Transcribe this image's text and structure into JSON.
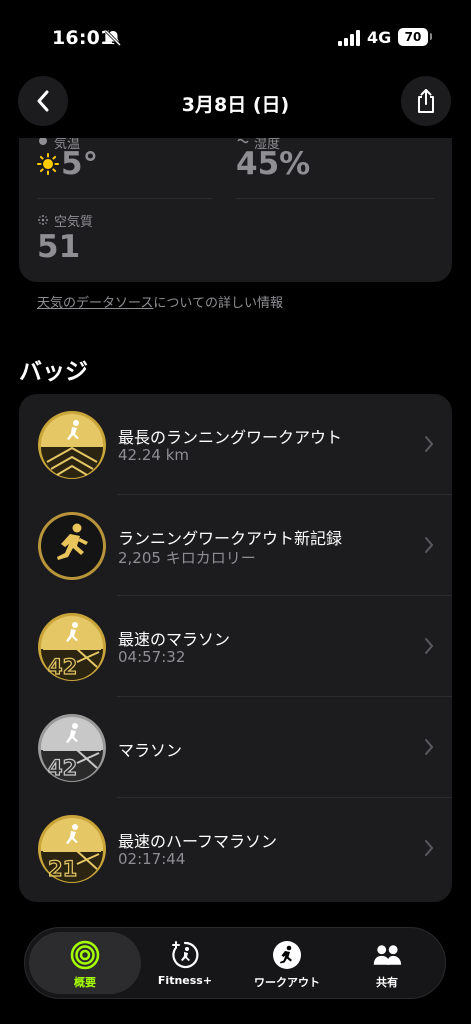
{
  "status_bar": {
    "time": "16:01",
    "network": "4G",
    "battery": "70"
  },
  "nav": {
    "title": "3月8日 (日)"
  },
  "weather": {
    "temp_label": "気温",
    "temp_value": "5°",
    "humidity_label": "湿度",
    "humidity_value": "45%",
    "air_label": "空気質",
    "air_value": "51",
    "source_link": "天気のデータソース",
    "source_suffix": "についての詳しい情報"
  },
  "badges": {
    "section_title": "バッジ",
    "items": [
      {
        "title": "最長のランニングワークアウト",
        "subtitle": "42.24 km",
        "medal": "gold-longest-run-badge-icon"
      },
      {
        "title": "ランニングワークアウト新記録",
        "subtitle": "2,205 キロカロリー",
        "medal": "black-gold-running-record-badge-icon"
      },
      {
        "title": "最速のマラソン",
        "subtitle": "04:57:32",
        "medal": "gold-marathon-42-badge-icon"
      },
      {
        "title": "マラソン",
        "subtitle": "",
        "medal": "silver-marathon-42-badge-icon"
      },
      {
        "title": "最速のハーフマラソン",
        "subtitle": "02:17:44",
        "medal": "gold-half-marathon-21-badge-icon"
      }
    ]
  },
  "tabs": [
    {
      "label": "概要",
      "icon": "activity-rings-icon",
      "active": true
    },
    {
      "label": "Fitness+",
      "icon": "fitness-plus-icon",
      "active": false
    },
    {
      "label": "ワークアウト",
      "icon": "running-figure-icon",
      "active": false
    },
    {
      "label": "共有",
      "icon": "people-icon",
      "active": false
    }
  ],
  "colors": {
    "accent": "#a6ff00",
    "gold": "#d9b84a",
    "silver": "#b5b5b5",
    "card": "#1c1c1e"
  }
}
